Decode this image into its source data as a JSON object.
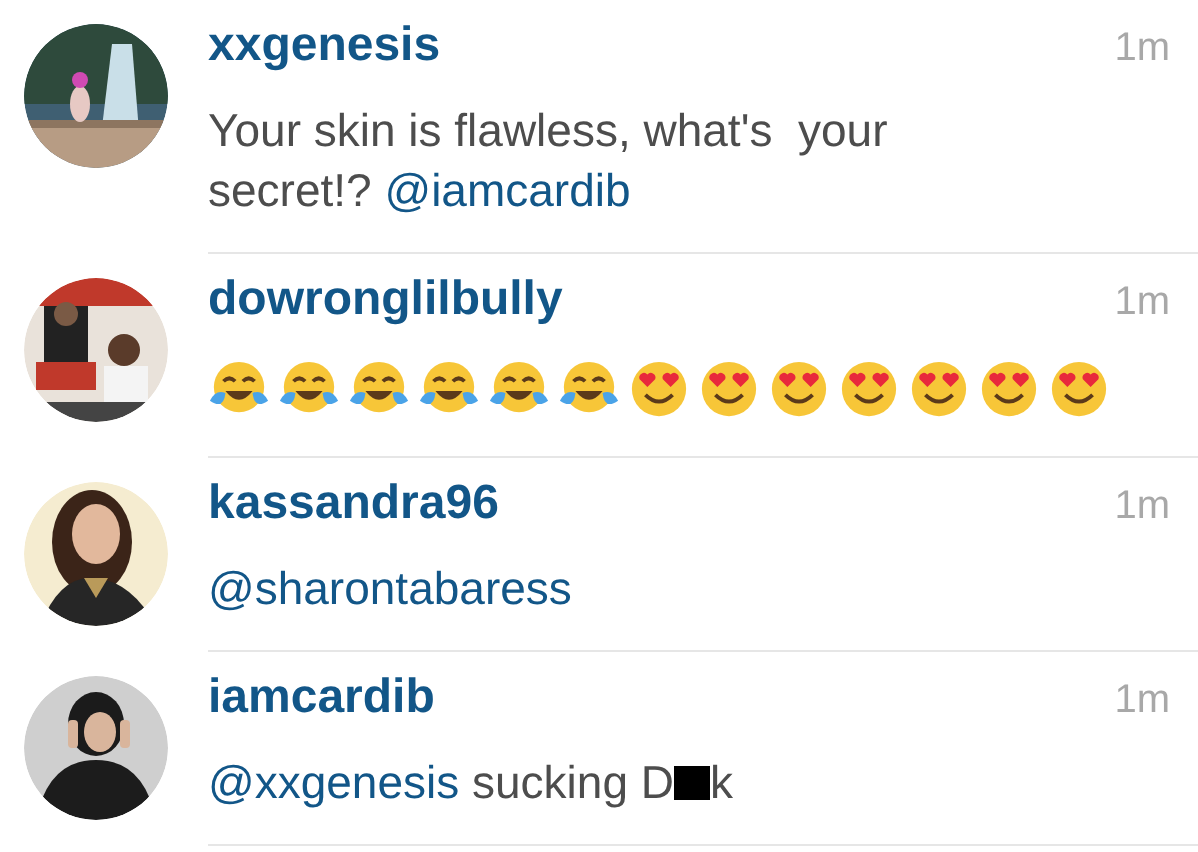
{
  "comments": [
    {
      "avatar": {
        "kind": "picture"
      },
      "username": "xxgenesis",
      "time": "1m",
      "body": [
        {
          "kind": "text",
          "text": "Your skin is flawless, what's  your secret!? "
        },
        {
          "kind": "mention",
          "text": "@iamcardib"
        }
      ]
    },
    {
      "avatar": {
        "kind": "picture"
      },
      "username": "dowronglilbully",
      "time": "1m",
      "emojis": [
        {
          "kind": "tears-of-joy"
        },
        {
          "kind": "tears-of-joy"
        },
        {
          "kind": "tears-of-joy"
        },
        {
          "kind": "tears-of-joy"
        },
        {
          "kind": "tears-of-joy"
        },
        {
          "kind": "tears-of-joy"
        },
        {
          "kind": "heart-eyes"
        },
        {
          "kind": "heart-eyes"
        },
        {
          "kind": "heart-eyes"
        },
        {
          "kind": "heart-eyes"
        },
        {
          "kind": "heart-eyes"
        },
        {
          "kind": "heart-eyes"
        },
        {
          "kind": "heart-eyes"
        }
      ]
    },
    {
      "avatar": {
        "kind": "picture"
      },
      "username": "kassandra96",
      "time": "1m",
      "body": [
        {
          "kind": "mention",
          "text": "@sharontabaress"
        }
      ]
    },
    {
      "avatar": {
        "kind": "picture"
      },
      "username": "iamcardib",
      "time": "1m",
      "body": [
        {
          "kind": "mention",
          "text": "@xxgenesis"
        },
        {
          "kind": "text",
          "text": " sucking D"
        },
        {
          "kind": "redaction"
        },
        {
          "kind": "text",
          "text": "k"
        }
      ]
    }
  ]
}
